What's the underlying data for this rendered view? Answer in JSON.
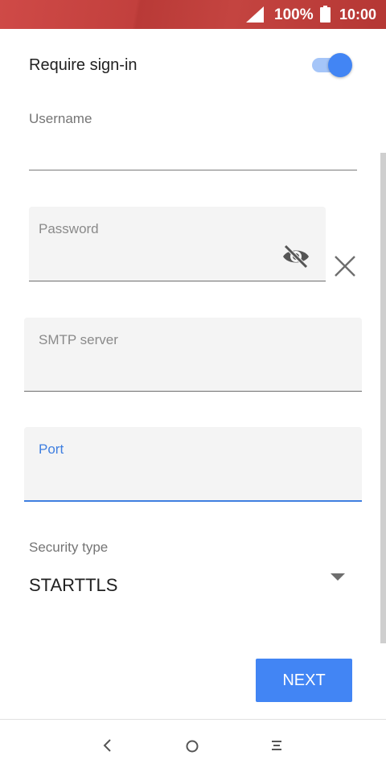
{
  "status_bar": {
    "battery_percent": "100%",
    "time": "10:00",
    "background_color": "#c2403d",
    "icons": [
      "signal-icon",
      "battery-icon"
    ]
  },
  "form": {
    "require_signin_label": "Require sign-in",
    "require_signin_enabled": true,
    "username": {
      "label": "Username",
      "value": ""
    },
    "password": {
      "label": "Password",
      "value": ""
    },
    "smtp_server": {
      "label": "SMTP server",
      "value": ""
    },
    "port": {
      "label": "Port",
      "value": "",
      "focused": true
    },
    "security_type": {
      "label": "Security type",
      "value": "STARTTLS"
    }
  },
  "actions": {
    "next_label": "NEXT"
  },
  "colors": {
    "accent": "#4285f4",
    "focus": "#3f7fe0"
  },
  "nav_bar": {
    "icons": [
      "back-icon",
      "home-icon",
      "recents-icon"
    ]
  }
}
